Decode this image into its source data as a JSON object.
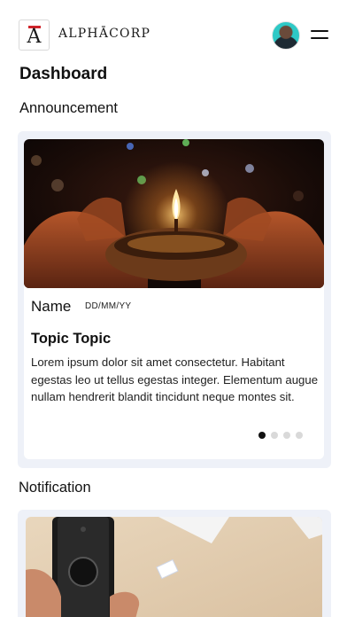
{
  "header": {
    "logo_letter": "A",
    "brand": "ALPHĀCORP"
  },
  "page": {
    "title": "Dashboard"
  },
  "announcement": {
    "section_title": "Announcement",
    "card": {
      "name": "Name",
      "date": "DD/MM/YY",
      "topic": "Topic Topic",
      "body": "Lorem ipsum dolor sit amet consectetur. Habitant egestas leo ut tellus egestas integer. Elementum augue nullam hendrerit blandit tincidunt neque montes sit.",
      "image": "diya-lamp-in-hands-photo"
    },
    "carousel": {
      "total": 4,
      "active": 1
    }
  },
  "notification": {
    "section_title": "Notification",
    "image": "smart-doorbell-photo"
  },
  "colors": {
    "accent_red": "#d0242b",
    "card_bg": "#eef1f8",
    "avatar_bg": "#2ec9c6"
  }
}
